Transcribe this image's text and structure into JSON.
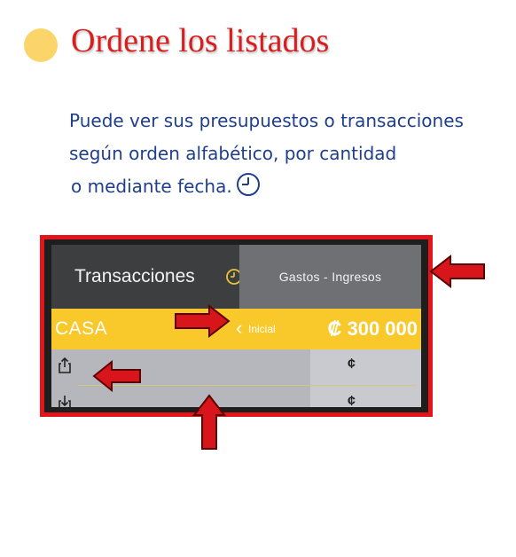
{
  "title": "Ordene los listados",
  "description": {
    "line1": "Puede ver sus presupuestos o transacciones",
    "line2": "según orden alfabético, por cantidad",
    "line3": "o mediante fecha."
  },
  "screenshot": {
    "tab_transactions": "Transacciones",
    "tab_expenses_income": "Gastos - Ingresos",
    "budget_name": "CASA",
    "back_glyph": "‹",
    "back_label": "Inicial",
    "budget_amount": "₡ 300 000",
    "currency_symbol_1": "¢",
    "currency_symbol_2": "¢"
  },
  "icons": {
    "bullet": "circle-bullet-icon",
    "clock": "clock-icon",
    "export": "share-out-icon",
    "import": "share-in-icon",
    "arrows": "red-arrow-icon"
  },
  "colors": {
    "title": "#d81e1e",
    "description": "#1f3f8c",
    "bullet": "#fbd56a",
    "frame": "#e4141b",
    "budget_bar": "#f9c92c"
  }
}
